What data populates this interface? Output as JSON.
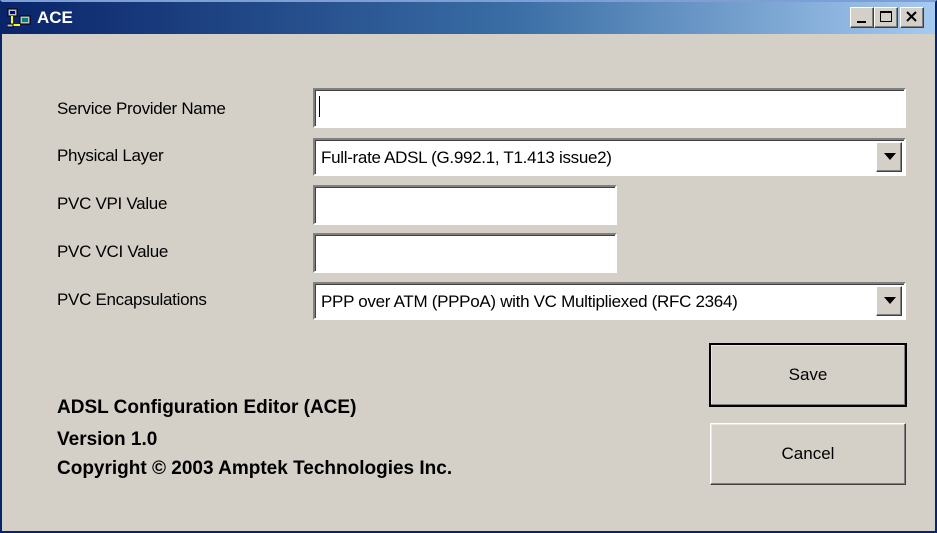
{
  "window": {
    "title": "ACE",
    "controls": [
      "minimize-icon",
      "maximize-icon",
      "close-icon"
    ]
  },
  "form": {
    "service_provider_name": {
      "label": "Service Provider Name",
      "value": ""
    },
    "physical_layer": {
      "label": "Physical Layer",
      "value": "Full-rate ADSL (G.992.1, T1.413 issue2)"
    },
    "pvc_vpi": {
      "label": "PVC VPI Value",
      "value": ""
    },
    "pvc_vci": {
      "label": "PVC VCI Value",
      "value": ""
    },
    "pvc_encapsulations": {
      "label": "PVC Encapsulations",
      "value": "PPP over ATM (PPPoA) with VC Multipliexed (RFC 2364)"
    }
  },
  "buttons": {
    "save": "Save",
    "cancel": "Cancel"
  },
  "about": {
    "product": "ADSL Configuration Editor (ACE)",
    "version": "Version 1.0",
    "copyright": "Copyright © 2003 Amptek Technologies Inc."
  }
}
